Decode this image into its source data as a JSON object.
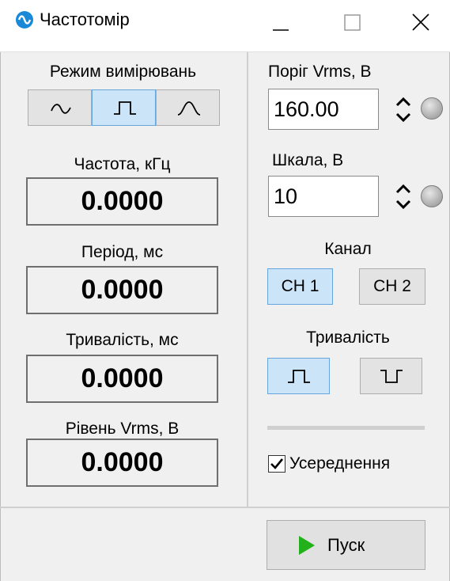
{
  "window": {
    "title": "Частотомір"
  },
  "left": {
    "mode_label": "Режим вимірювань",
    "mode_buttons": [
      {
        "icon": "sine-wave-icon",
        "selected": false
      },
      {
        "icon": "pulse-wave-icon",
        "selected": true
      },
      {
        "icon": "bell-wave-icon",
        "selected": false
      }
    ],
    "frequency": {
      "label": "Частота, кГц",
      "value": "0.0000"
    },
    "period": {
      "label": "Період, мс",
      "value": "0.0000"
    },
    "duration": {
      "label": "Тривалість, мс",
      "value": "0.0000"
    },
    "level": {
      "label": "Рівень Vrms, В",
      "value": "0.0000"
    }
  },
  "right": {
    "threshold": {
      "label": "Поріг Vrms, В",
      "value": "160.00"
    },
    "scale": {
      "label": "Шкала, В",
      "value": "10"
    },
    "channel": {
      "label": "Канал",
      "ch1": "CH 1",
      "ch2": "CH 2",
      "selected": "CH 1"
    },
    "pulse_duration": {
      "label": "Тривалість",
      "selected": "positive-pulse"
    },
    "averaging": {
      "label": "Усереднення",
      "checked": true
    }
  },
  "footer": {
    "start_label": "Пуск"
  },
  "colors": {
    "selected_bg": "#cce4f7",
    "selected_border": "#66a6dd",
    "start_icon": "#22b11a",
    "app_icon": "#1a8ad8"
  }
}
